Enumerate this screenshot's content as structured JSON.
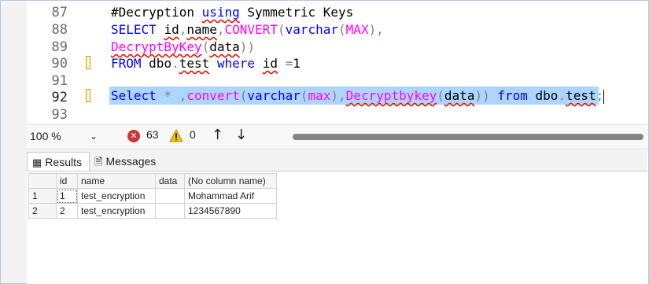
{
  "editor": {
    "lines": [
      {
        "num": "87"
      },
      {
        "num": "88"
      },
      {
        "num": "89"
      },
      {
        "num": "90"
      },
      {
        "num": "91"
      },
      {
        "num": "92"
      },
      {
        "num": "93"
      }
    ],
    "t": {
      "l87_a": "#Decryption ",
      "l87_b": "using",
      "l87_c": " Symmetric Keys",
      "l88_a": "SELECT ",
      "l88_b": "id",
      "l88_c": ",",
      "l88_d": "name",
      "l88_e": ",",
      "l88_f": "CONVERT",
      "l88_g": "(",
      "l88_h": "varchar",
      "l88_i": "(",
      "l88_j": "MAX",
      "l88_k": "),",
      "l89_a": "DecryptByKey",
      "l89_b": "(",
      "l89_c": "data",
      "l89_d": "))",
      "l90_a": "FROM ",
      "l90_b": "dbo",
      "l90_c": ".",
      "l90_d": "test",
      "l90_e": " where ",
      "l90_f": "id",
      "l90_g": " =",
      "l90_h": "1",
      "l92_a": "Select ",
      "l92_b": "*",
      "l92_c": " ,",
      "l92_d": "convert",
      "l92_e": "(",
      "l92_f": "varchar",
      "l92_g": "(",
      "l92_h": "max",
      "l92_i": "),",
      "l92_j": "Decryptbykey",
      "l92_k": "(",
      "l92_l": "data",
      "l92_m": ")) ",
      "l92_n": "from",
      "l92_o": " ",
      "l92_p": "dbo",
      "l92_q": ".",
      "l92_r": "test",
      "l92_s": ";"
    }
  },
  "status": {
    "zoom": "100 %",
    "errors": "63",
    "warnings": "0",
    "up_arrow": "↑",
    "down_arrow": "↓",
    "chevron": "⌄"
  },
  "tabs": {
    "results": "Results",
    "messages": "Messages"
  },
  "grid": {
    "columns": [
      "id",
      "name",
      "data",
      "(No column name)"
    ],
    "rows": [
      {
        "rownum": "1",
        "id": "1",
        "name": "test_encryption",
        "data": "",
        "col": "Mohammad Arif"
      },
      {
        "rownum": "2",
        "id": "2",
        "name": "test_encryption",
        "data": "",
        "col": "1234567890"
      }
    ]
  },
  "icons": {
    "error": "error-icon",
    "warning": "warning-icon",
    "results": "grid-icon",
    "messages": "messages-icon"
  },
  "colors": {
    "keyword": "#0000ff",
    "function": "#ff00ff",
    "selection": "#add6ff",
    "error": "#d13438",
    "warning": "#c8a000"
  }
}
